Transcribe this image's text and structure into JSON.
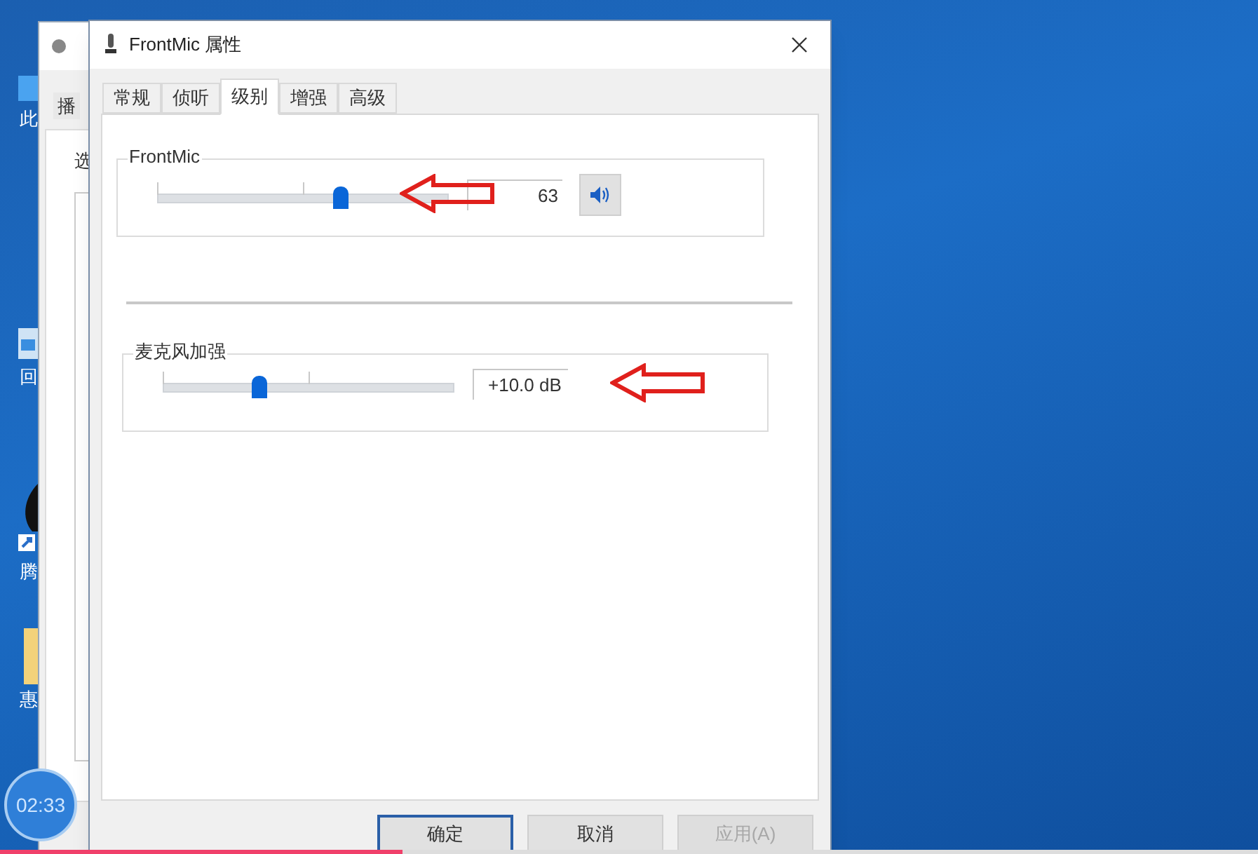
{
  "desktop_icons": [
    {
      "label": "此",
      "kind": "computer"
    },
    {
      "label": "回",
      "kind": "recycle"
    },
    {
      "label": "腾",
      "kind": "shortcut"
    },
    {
      "label": "惠",
      "kind": "folder"
    }
  ],
  "background_window": {
    "tab": "播",
    "label": "选"
  },
  "dialog": {
    "title": "FrontMic 属性",
    "tabs": [
      {
        "label": "常规",
        "selected": false
      },
      {
        "label": "侦听",
        "selected": false
      },
      {
        "label": "级别",
        "selected": true
      },
      {
        "label": "增强",
        "selected": false
      },
      {
        "label": "高级",
        "selected": false
      }
    ],
    "groups": [
      {
        "kind": "volume",
        "title": "FrontMic",
        "level": 0.63,
        "reading": "63",
        "muted": false
      },
      {
        "kind": "boost",
        "title": "麦克风加强",
        "level": 0.33,
        "reading": "+10.0 dB"
      }
    ],
    "buttons": [
      {
        "label": "确定",
        "default": true,
        "disabled": false
      },
      {
        "label": "取消",
        "default": false,
        "disabled": false
      },
      {
        "label": "应用(A)",
        "default": false,
        "disabled": true
      }
    ]
  },
  "recording_timer": "02:33",
  "video_progress": {
    "level": 0.32
  }
}
